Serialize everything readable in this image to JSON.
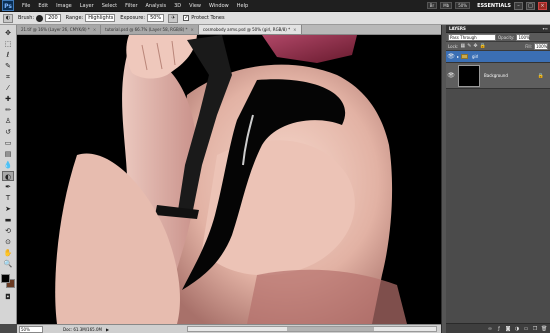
{
  "app": {
    "logo": "Ps",
    "menu": [
      "File",
      "Edit",
      "Image",
      "Layer",
      "Select",
      "Filter",
      "Analysis",
      "3D",
      "View",
      "Window",
      "Help"
    ],
    "toolbar_right": [
      "Br",
      "Mb",
      "50%"
    ],
    "workspace": "ESSENTIALS",
    "window_controls": [
      "–",
      "□",
      "×"
    ]
  },
  "options": {
    "brush_label": "Brush:",
    "brush_size": "200",
    "range_label": "Range:",
    "range_value": "Highlights",
    "exposure_label": "Exposure:",
    "exposure_value": "50%",
    "protect_tones_label": "Protect Tones",
    "protect_tones_checked": "✓"
  },
  "tabs": [
    {
      "label": "21.tif @ 16% (Layer 26, CMYK/8) *",
      "close": "×"
    },
    {
      "label": "tutorial.psd @ 66.7% (Layer 58, RGB/8) *",
      "close": "×"
    },
    {
      "label": "cosmobody arms.psd @ 50% (girl, RGB/8) *",
      "close": "×"
    }
  ],
  "status": {
    "zoom": "50%",
    "doc_info": "Doc: 61.3M/165.0M",
    "arrow": "▶"
  },
  "layers_panel": {
    "tab": "LAYERS",
    "menu": "▾≡",
    "blend_mode": "Pass Through",
    "opacity_label": "Opacity:",
    "opacity_value": "100%",
    "lock_label": "Lock:",
    "fill_label": "Fill:",
    "fill_value": "100%",
    "layers": [
      {
        "name": "girl",
        "type": "group",
        "selected": true
      },
      {
        "name": "Background",
        "type": "pixel",
        "selected": false,
        "locked": true
      }
    ],
    "footer_icons": [
      "link-icon",
      "fx-icon",
      "mask-icon",
      "adjustment-icon",
      "folder-icon",
      "new-layer-icon",
      "trash-icon"
    ]
  },
  "colors": {
    "foreground": "#000000",
    "background": "#6a3a22",
    "accent": "#3b6fb4"
  }
}
